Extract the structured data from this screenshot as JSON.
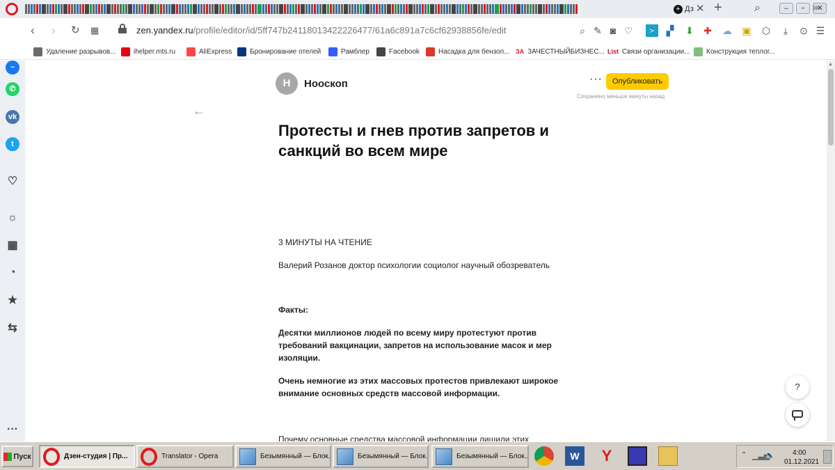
{
  "browser": {
    "active_tab_label": "Дз",
    "new_tab_label": "+",
    "tab_close_label": "✕",
    "url_host": "zen.yandex.ru",
    "url_path": "/profile/editor/id/5ff747b24118013422226477/61a6c891a7c6cf62938856fe/edit"
  },
  "bookmarks": [
    {
      "label": "Удаление разрывов...",
      "icon": "document-icon",
      "color": "#6b6b6b"
    },
    {
      "label": "ihelper.mts.ru",
      "icon": "mts-icon",
      "color": "#e30611"
    },
    {
      "label": "AliExpress",
      "icon": "aliexpress-icon",
      "color": "#ff4747"
    },
    {
      "label": "Бронирование отелей",
      "icon": "booking-icon",
      "color": "#003580"
    },
    {
      "label": "Рамблер",
      "icon": "rambler-icon",
      "color": "#315efb"
    },
    {
      "label": "Facebook",
      "icon": "document-icon",
      "color": "#444444"
    },
    {
      "label": "Насадка для бензоп...",
      "icon": "pin-icon",
      "color": "#d93a2b"
    },
    {
      "label": "ЗАЧЕСТНЫЙБИЗНЕС...",
      "icon": "za-icon",
      "color": "#d92a2a",
      "icon_text": "ЗА"
    },
    {
      "label": "Связи организации...",
      "icon": "list-org-icon",
      "color": "#c8102e",
      "icon_text": "List"
    },
    {
      "label": "Конструкция теплог...",
      "icon": "link-icon",
      "color": "#7fbf7f"
    }
  ],
  "sidebar": [
    {
      "icon": "messenger-icon",
      "color": "#1877f2"
    },
    {
      "icon": "whatsapp-icon",
      "color": "#25d366"
    },
    {
      "icon": "vk-icon",
      "color": "#4a76a8",
      "text": "vk"
    },
    {
      "icon": "twitter-icon",
      "color": "#1da1f2"
    },
    {
      "icon": "heart-icon"
    },
    {
      "icon": "lightbulb-icon"
    },
    {
      "icon": "grid-icon"
    },
    {
      "icon": "clock-icon"
    },
    {
      "icon": "star-icon"
    },
    {
      "icon": "translate-icon"
    },
    {
      "icon": "more-icon"
    }
  ],
  "editor": {
    "channel_initial": "Н",
    "channel_name": "Нооскоп",
    "more_label": "···",
    "publish_label": "Опубликовать",
    "saved_status": "Сохранено меньше минуты назад",
    "back_label": "←",
    "title": "Протесты и гнев против запретов и санкций во всем мире",
    "paragraphs": [
      {
        "text": "3 МИНУТЫ НА ЧТЕНИЕ",
        "bold": false
      },
      {
        "text": "Валерий Розанов доктор психологии социолог научный обозреватель",
        "bold": false
      },
      {
        "text": "Факты:",
        "bold": true
      },
      {
        "text": "Десятки миллионов людей по всему миру протестуют против требований вакцинации, запретов на использование масок и мер изоляции.",
        "bold": true
      },
      {
        "text": "Очень немногие из этих массовых протестов привлекают широкое внимание основных средств массовой информации.",
        "bold": true
      },
      {
        "text": "Почему основные средства массовой информации лишили этих",
        "bold": false
      }
    ],
    "help_label": "?"
  },
  "taskbar": {
    "start_label": "Пуск",
    "tasks": [
      {
        "label": "Дзен-студия | Пр...",
        "icon": "opera-icon",
        "active": true
      },
      {
        "label": "Translator - Opera",
        "icon": "opera-icon",
        "active": false
      },
      {
        "label": "Безымянный — Блок...",
        "icon": "notepad-icon",
        "active": false
      },
      {
        "label": "Безымянный — Блок...",
        "icon": "notepad-icon",
        "active": false
      },
      {
        "label": "Безымянный — Блок...",
        "icon": "notepad-icon",
        "active": false
      }
    ],
    "quick_launch": [
      "chrome-icon",
      "word-icon",
      "yandex-icon",
      "save-icon",
      "folder-icon"
    ],
    "clock_time": "4:00",
    "clock_date": "01.12.2021"
  }
}
